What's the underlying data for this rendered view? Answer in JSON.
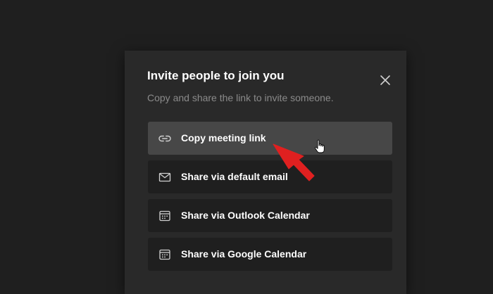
{
  "dialog": {
    "title": "Invite people to join you",
    "subtitle": "Copy and share the link to invite someone.",
    "close_icon": "close-icon"
  },
  "options": [
    {
      "label": "Copy meeting link",
      "icon": "link-icon",
      "highlighted": true
    },
    {
      "label": "Share via default email",
      "icon": "mail-icon",
      "highlighted": false
    },
    {
      "label": "Share via Outlook Calendar",
      "icon": "calendar-icon",
      "highlighted": false
    },
    {
      "label": "Share via Google Calendar",
      "icon": "calendar-icon",
      "highlighted": false
    }
  ],
  "annotation": {
    "arrow_color": "#e02020",
    "cursor": "hand-pointer-cursor"
  },
  "colors": {
    "background": "#1f1f1f",
    "dialog": "#292929",
    "option": "#1f1f1f",
    "option_highlight": "#474747"
  }
}
